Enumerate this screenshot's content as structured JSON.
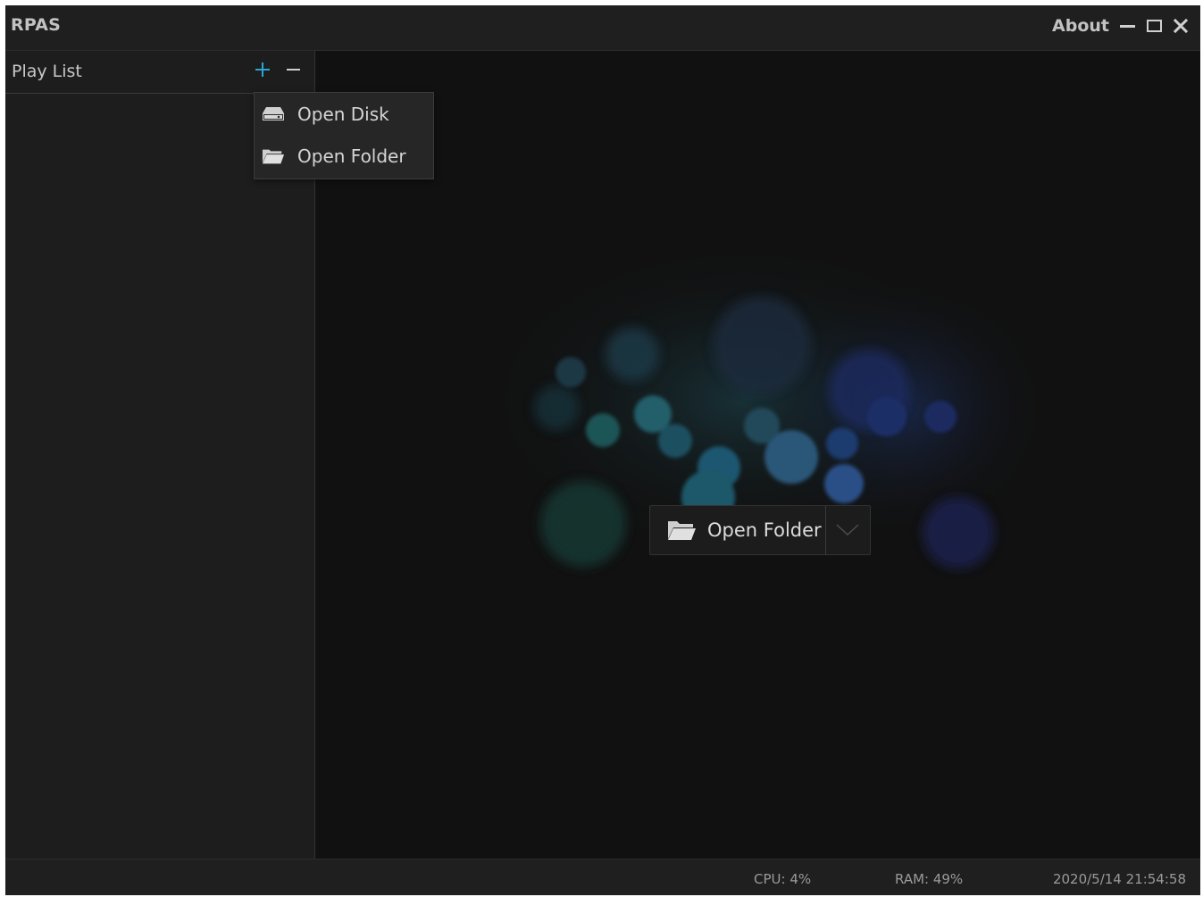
{
  "app": {
    "title": "RPAS",
    "about_label": "About"
  },
  "sidebar": {
    "title": "Play List"
  },
  "menu": {
    "items": [
      {
        "label": "Open Disk",
        "icon": "disk-icon"
      },
      {
        "label": "Open Folder",
        "icon": "folder-icon"
      }
    ]
  },
  "main": {
    "open_folder_label": "Open Folder"
  },
  "status": {
    "cpu": "CPU: 4%",
    "ram": "RAM: 49%",
    "datetime": "2020/5/14 21:54:58"
  },
  "colors": {
    "accent": "#2aa6d6",
    "background": "#111111",
    "panel": "#1f1f1f"
  }
}
